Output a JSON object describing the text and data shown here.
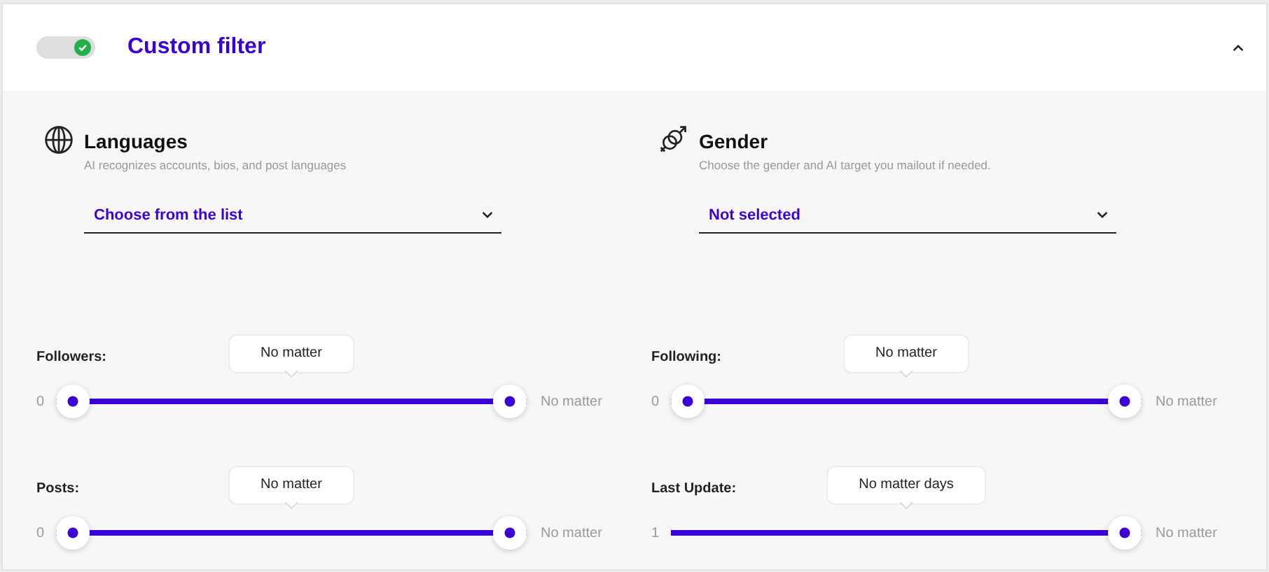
{
  "header": {
    "toggle": {
      "on": true
    },
    "title": "Custom filter",
    "expanded": true
  },
  "filters": [
    {
      "kind": "languages",
      "title": "Languages",
      "subtitle": "AI recognizes accounts, bios, and post languages",
      "value": "Choose from the list"
    },
    {
      "kind": "gender",
      "title": "Gender",
      "subtitle": "Choose the gender and AI target you mailout if needed.",
      "value": "Not selected"
    }
  ],
  "sliders": [
    {
      "kind": "range",
      "label": "Followers:",
      "tooltip": "No matter",
      "min": "0",
      "max": "No matter",
      "level": 1
    },
    {
      "kind": "range",
      "label": "Following:",
      "tooltip": "No matter",
      "min": "0",
      "max": "No matter",
      "level": 1
    },
    {
      "kind": "range",
      "label": "Posts:",
      "tooltip": "No matter",
      "min": "0",
      "max": "No matter",
      "level": 1
    },
    {
      "kind": "single",
      "label": "Last Update:",
      "tooltip": "No matter days",
      "min": "1",
      "max": "No matter",
      "level": 1
    }
  ]
}
